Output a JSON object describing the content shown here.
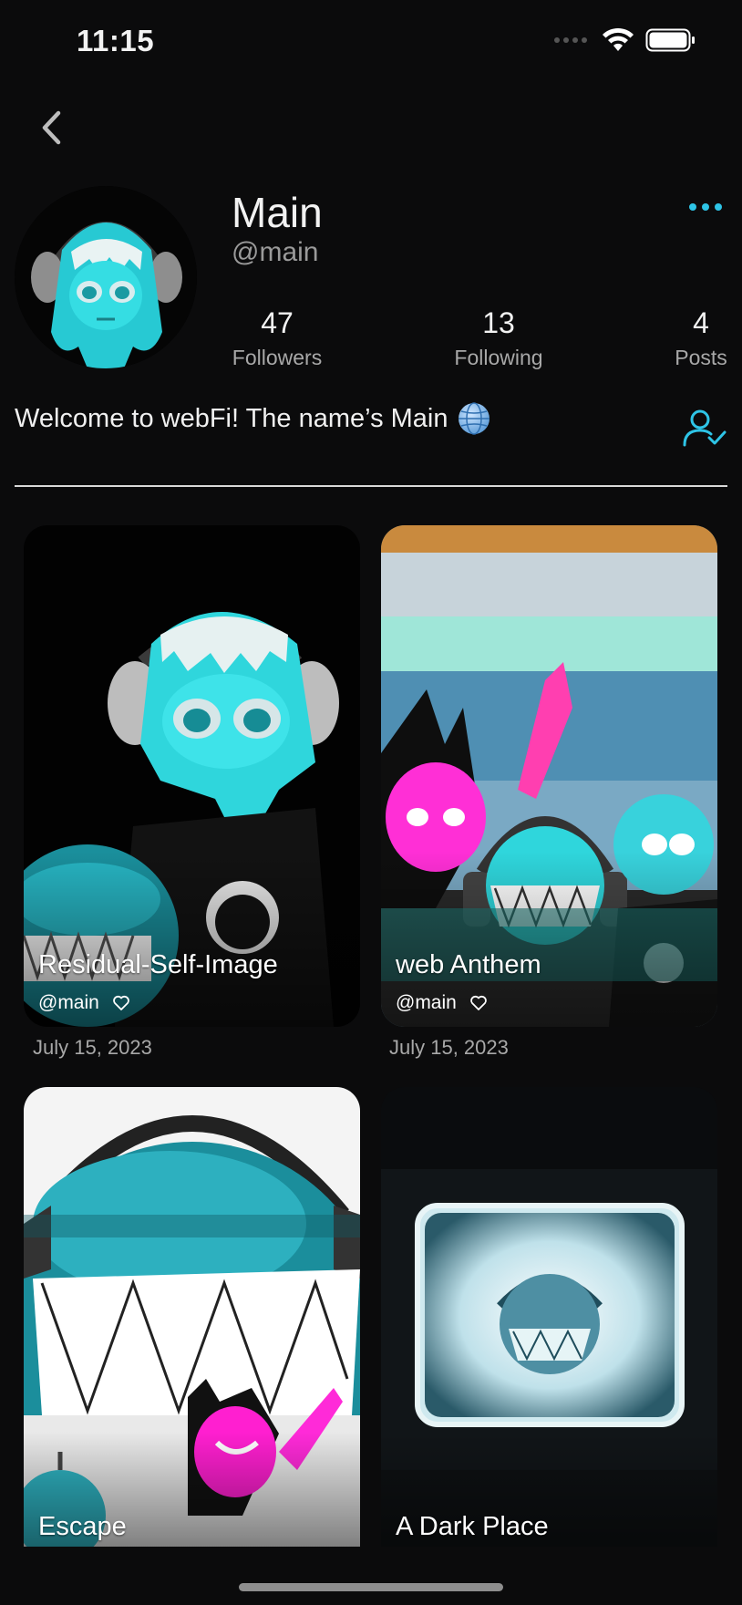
{
  "status_bar": {
    "time": "11:15"
  },
  "profile": {
    "name": "Main",
    "handle": "@main",
    "bio": "Welcome to webFi! The name’s Main",
    "stats": [
      {
        "value": "47",
        "label": "Followers"
      },
      {
        "value": "13",
        "label": "Following"
      },
      {
        "value": "4",
        "label": "Posts"
      }
    ]
  },
  "posts": [
    {
      "title": "Residual-Self-Image",
      "author": "@main",
      "date": "July 15, 2023"
    },
    {
      "title": "web Anthem",
      "author": "@main",
      "date": "July 15, 2023"
    },
    {
      "title": "Escape"
    },
    {
      "title": "A Dark Place"
    }
  ],
  "colors": {
    "accent": "#2ec4e6",
    "background": "#0b0b0c",
    "cyan_character": "#2fd6dc",
    "magenta_character": "#ff1fd0"
  },
  "icons": {
    "back": "chevron-left-icon",
    "more": "ellipsis-icon",
    "follow_status": "user-check-icon",
    "like": "heart-icon",
    "bio_emoji": "globe-icon"
  }
}
